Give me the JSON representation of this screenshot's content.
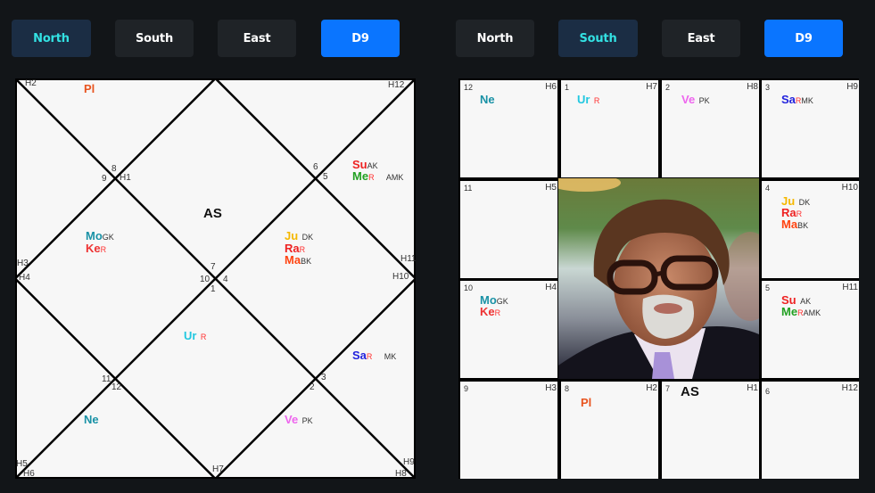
{
  "left_toolbar": {
    "buttons": [
      {
        "label": "North",
        "state": "active"
      },
      {
        "label": "South",
        "state": "normal"
      },
      {
        "label": "East",
        "state": "normal"
      },
      {
        "label": "D9",
        "state": "primary"
      }
    ]
  },
  "right_toolbar": {
    "buttons": [
      {
        "label": "North",
        "state": "normal"
      },
      {
        "label": "South",
        "state": "active"
      },
      {
        "label": "East",
        "state": "normal"
      },
      {
        "label": "D9",
        "state": "primary"
      }
    ]
  },
  "colors": {
    "active_text": "#33e1e3",
    "active_bg": "#1b2d44",
    "primary_bg": "#0a75ff",
    "button_bg": "#1f2327",
    "page_bg": "#121518",
    "chart_bg": "#f7f7f7"
  },
  "planets": {
    "Pl": {
      "abbr": "Pl",
      "color": "#e8541f"
    },
    "Su": {
      "abbr": "Su",
      "color": "#ee2222",
      "karaka": "AK"
    },
    "Me": {
      "abbr": "Me",
      "color": "#22a022",
      "retro": "R",
      "karaka": "AMK"
    },
    "Mo": {
      "abbr": "Mo",
      "color": "#1a92a6",
      "karaka": "GK"
    },
    "Ke": {
      "abbr": "Ke",
      "color": "#ee3333",
      "retro": "R"
    },
    "Ju": {
      "abbr": "Ju",
      "color": "#f5b800",
      "karaka": "DK"
    },
    "Ra": {
      "abbr": "Ra",
      "color": "#ee2222",
      "retro": "R"
    },
    "Ma": {
      "abbr": "Ma",
      "color": "#ff4411",
      "karaka": "BK"
    },
    "Ur": {
      "abbr": "Ur",
      "color": "#22c8e0",
      "retro": "R"
    },
    "Sa": {
      "abbr": "Sa",
      "color": "#2222dd",
      "retro": "R",
      "karaka": "MK"
    },
    "Ne": {
      "abbr": "Ne",
      "color": "#1a92a6"
    },
    "Ve": {
      "abbr": "Ve",
      "color": "#ee66ee",
      "karaka": "PK"
    }
  },
  "north_chart": {
    "ascendant_label": "AS",
    "sign_numbers": [
      "8",
      "9",
      "6",
      "5",
      "7",
      "10",
      "4",
      "1",
      "11",
      "12",
      "3",
      "2"
    ],
    "house_labels": [
      "H1",
      "H2",
      "H3",
      "H4",
      "H5",
      "H6",
      "H7",
      "H8",
      "H9",
      "H10",
      "H11",
      "H12"
    ],
    "placements": {
      "H2": [
        "Pl"
      ],
      "H12": [
        "Su",
        "Me"
      ],
      "H3": [
        "Mo",
        "Ke"
      ],
      "H11": [
        "Ju",
        "Ra",
        "Ma"
      ],
      "H1": [],
      "H4": [
        "Ur"
      ],
      "H10": [
        "Sa"
      ],
      "H6": [
        "Ne"
      ],
      "H8": [
        "Ve"
      ]
    }
  },
  "south_chart": {
    "ascendant_label": "AS",
    "photo_alt": "Native portrait",
    "cells": [
      {
        "sign": "12",
        "house": "H6",
        "planets": [
          "Ne"
        ]
      },
      {
        "sign": "1",
        "house": "H7",
        "planets": [
          "Ur"
        ]
      },
      {
        "sign": "2",
        "house": "H8",
        "planets": [
          "Ve"
        ]
      },
      {
        "sign": "3",
        "house": "H9",
        "planets": [
          "Sa"
        ]
      },
      {
        "sign": "11",
        "house": "H5",
        "planets": []
      },
      {
        "sign": "4",
        "house": "H10",
        "planets": [
          "Ju",
          "Ra",
          "Ma"
        ]
      },
      {
        "sign": "10",
        "house": "H4",
        "planets": [
          "Mo",
          "Ke"
        ]
      },
      {
        "sign": "5",
        "house": "H11",
        "planets": [
          "Su",
          "Me"
        ]
      },
      {
        "sign": "9",
        "house": "H3",
        "planets": []
      },
      {
        "sign": "8",
        "house": "H2",
        "planets": [
          "Pl"
        ]
      },
      {
        "sign": "7",
        "house": "H1",
        "planets": [],
        "ascendant": true
      },
      {
        "sign": "6",
        "house": "H12",
        "planets": []
      }
    ]
  }
}
